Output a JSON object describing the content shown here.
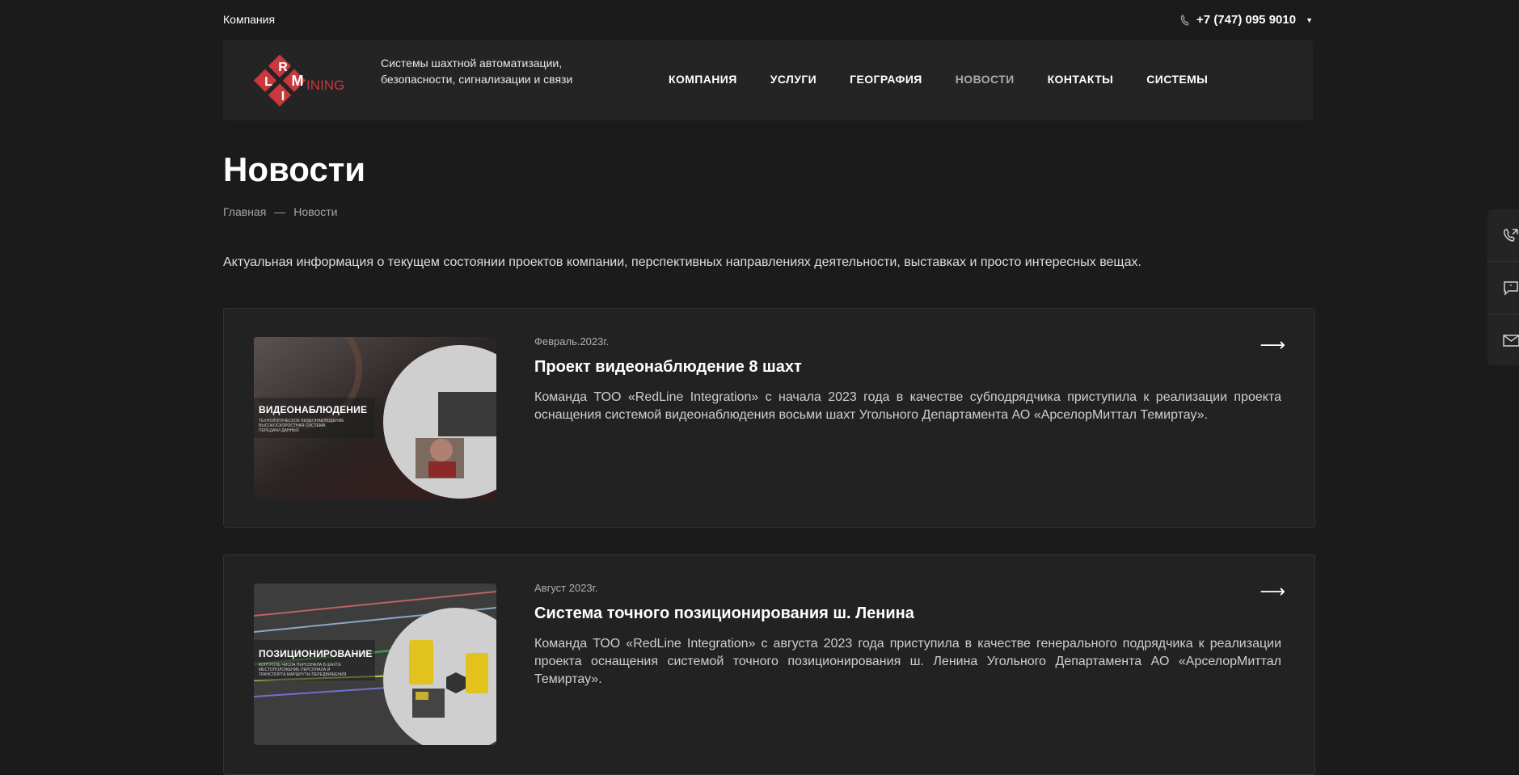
{
  "topbar": {
    "company_label": "Компания",
    "phone": "+7 (747) 095 9010"
  },
  "header": {
    "logo_text": "MINING",
    "slogan": "Системы шахтной автоматизации, безопасности, сигнализации и связи",
    "nav": [
      {
        "label": "КОМПАНИЯ"
      },
      {
        "label": "УСЛУГИ"
      },
      {
        "label": "ГЕОГРАФИЯ"
      },
      {
        "label": "НОВОСТИ",
        "active": true
      },
      {
        "label": "КОНТАКТЫ"
      },
      {
        "label": "СИСТЕМЫ"
      }
    ]
  },
  "page": {
    "title": "Новости",
    "breadcrumb": [
      "Главная",
      "—",
      "Новости"
    ],
    "intro": "Актуальная информация о текущем состоянии проектов компании, перспективных направлениях деятельности, выставках и просто интересных вещах."
  },
  "news": [
    {
      "date": "Февраль.2023г.",
      "title": "Проект видеонаблюдение 8 шахт",
      "description": "Команда ТОО «RedLine Integration» с начала 2023 года в качестве субподрядчика приступила к реализации проекта оснащения системой видеонаблюдения восьми шахт Угольного Департамента АО «АрселорМиттал Темиртау».",
      "thumb_title": "ВИДЕОНАБЛЮДЕНИЕ",
      "thumb_sub": "ТЕХНОЛОГИЧЕСКОЕ ВИДЕОНАБЛЮДЕНИЕ ВЫСОКОСКОРОСТНАЯ СИСТЕМА ПЕРЕДАЧИ ДАННЫХ"
    },
    {
      "date": "Август 2023г.",
      "title": "Система точного позиционирования ш. Ленина",
      "description": "Команда ТОО «RedLine Integration» с августа 2023 года приступила в качестве генерального подрядчика к реализации проекта оснащения системой точного позиционирования ш. Ленина Угольного Департамента АО «АрселорМиттал Темиртау».",
      "thumb_title": "ПОЗИЦИОНИРОВАНИЕ",
      "thumb_sub": "КОНТРОЛЬ ЧИСЛА ПЕРСОНАЛА В ШАХТЕ МЕСТОПОЛОЖЕНИЕ ПЕРСОНАЛА И ТРАНСПОРТА МАРШРУТЫ ПЕРЕДВИЖЕНИЯ"
    }
  ],
  "colors": {
    "background": "#1b1b1b",
    "panel": "#242424",
    "card": "#222222",
    "logo_red": "#c8383d"
  }
}
